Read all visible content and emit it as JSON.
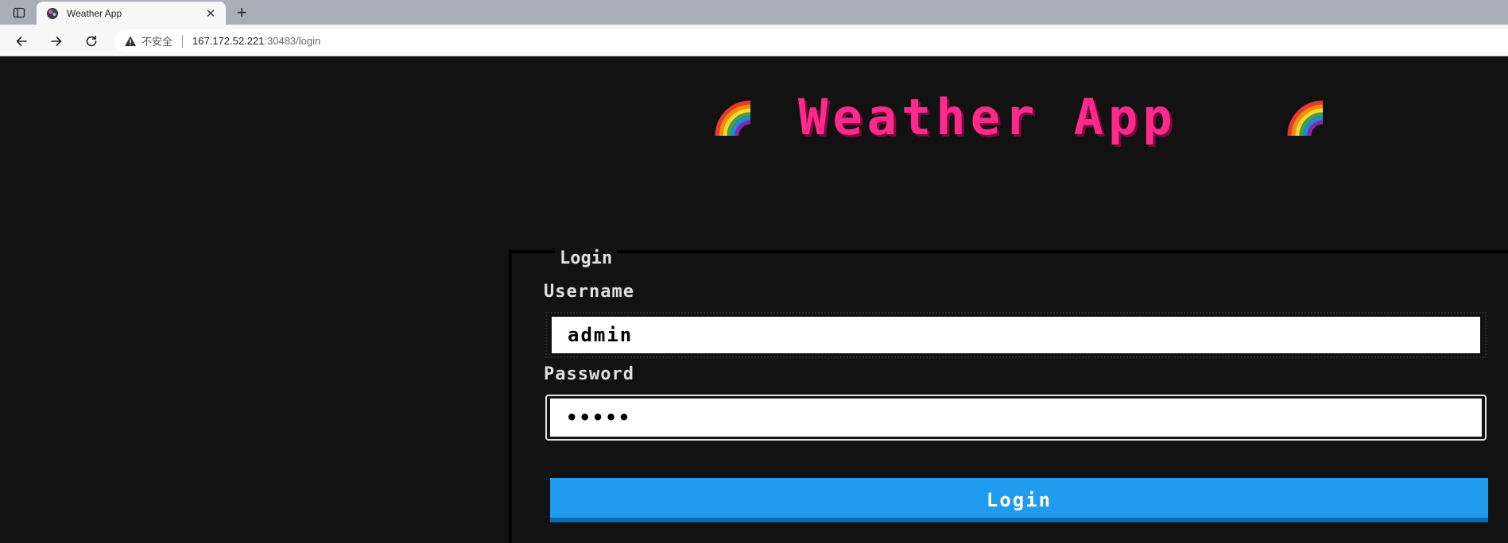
{
  "browser": {
    "tab_title": "Weather App",
    "close_glyph": "✕",
    "new_tab_glyph": "+",
    "security_label": "不安全",
    "url_host": "167.172.52.221",
    "url_path": ":30483/login"
  },
  "page": {
    "title": "Weather App",
    "login_legend": "Login",
    "username_label": "Username",
    "username_value": "admin",
    "password_label": "Password",
    "password_value": "•••••",
    "login_button": "Login"
  },
  "colors": {
    "title_pink": "#ff2a8b",
    "button_blue": "#209cee",
    "background": "#121212"
  },
  "icons": [
    "sidebar-toggle-icon",
    "weather-favicon-icon",
    "close-icon",
    "plus-icon",
    "back-arrow-icon",
    "forward-arrow-icon",
    "reload-icon",
    "warning-icon",
    "rainbow-icon"
  ]
}
